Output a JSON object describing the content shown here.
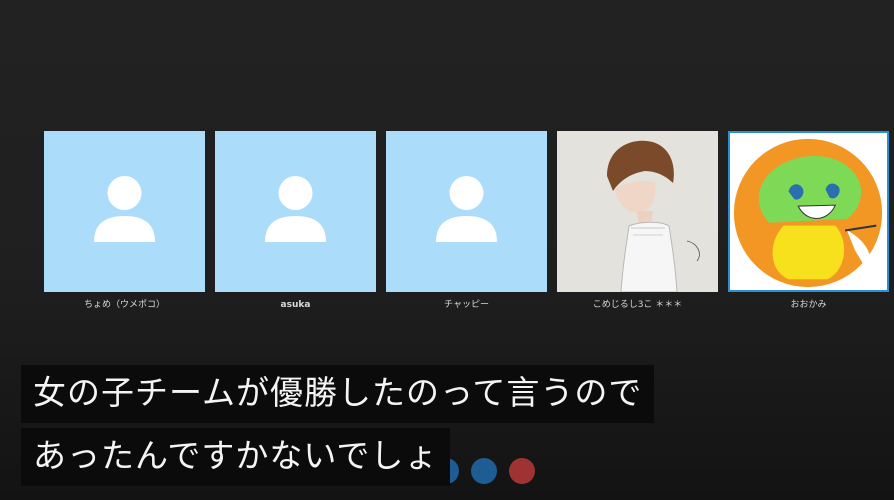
{
  "participants": [
    {
      "name": "ちょめ（ウメポコ）",
      "avatar": "default-person-icon"
    },
    {
      "name": "asuka",
      "avatar": "default-person-icon"
    },
    {
      "name": "チャッピー",
      "avatar": "default-person-icon"
    },
    {
      "name": "こめじるし3こ ＊＊＊",
      "avatar": "portrait-illustration"
    },
    {
      "name": "おおかみ",
      "avatar": "character-illustration",
      "active": true
    }
  ],
  "subtitles": {
    "line1": "女の子チームが優勝したのって言うので",
    "line2": "あったんですかないでしょ"
  },
  "colors": {
    "background": "#202020",
    "placeholder_avatar": "#abdcfa",
    "active_border": "#2b8fd6",
    "subtitle_bg": "#0b0b0b"
  }
}
